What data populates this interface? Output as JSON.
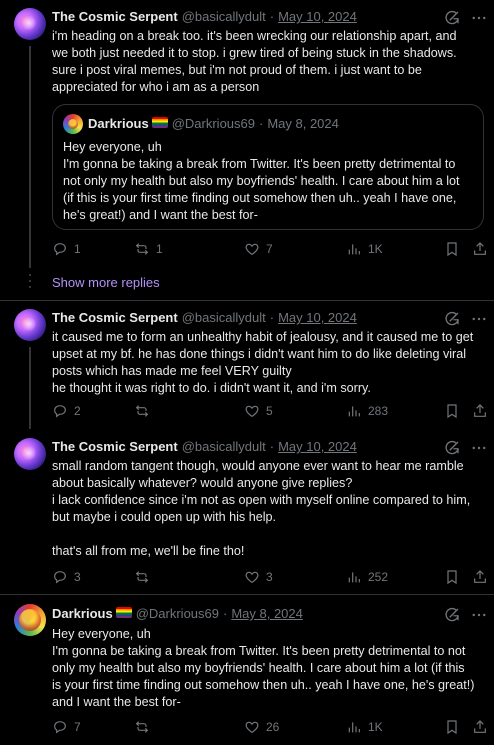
{
  "tweets": [
    {
      "name": "The Cosmic Serpent",
      "handle": "@basicallydult",
      "date": "May 10, 2024",
      "text": "i'm heading on a break too. it's been wrecking our relationship apart, and\nwe both just needed it to stop. i grew tired of being stuck in the shadows.\nsure i post viral memes, but i'm not proud of them. i just want to be\nappreciated for who i am as a person",
      "quote": {
        "name": "Darkrious",
        "handle": "@Darkrious69",
        "date": "May 8, 2024",
        "text": "Hey everyone, uh\nI'm gonna be taking a break from Twitter. It's been pretty detrimental to\nnot only my health but also my boyfriends' health. I care about him a lot\n(if this is your first time finding out somehow then uh.. yeah I have one,\nhe's great!) and I want the best for-"
      },
      "replies": "1",
      "retweets": "1",
      "likes": "7",
      "views": "1K"
    },
    {
      "name": "The Cosmic Serpent",
      "handle": "@basicallydult",
      "date": "May 10, 2024",
      "text": "it caused me to form an unhealthy habit of jealousy, and it caused me to get\nupset at my bf. he has done things i didn't want him to do like deleting viral\nposts which has made me feel VERY guilty\nhe thought it was right to do. i didn't want it, and i'm sorry.",
      "replies": "2",
      "retweets": "",
      "likes": "5",
      "views": "283"
    },
    {
      "name": "The Cosmic Serpent",
      "handle": "@basicallydult",
      "date": "May 10, 2024",
      "text": "small random tangent though, would anyone ever want to hear me ramble\nabout basically whatever? would anyone give replies?\ni lack confidence since i'm not as open with myself online compared to him,\nbut maybe i could open up with his help.\n\nthat's all from me, we'll be fine tho!",
      "replies": "3",
      "retweets": "",
      "likes": "3",
      "views": "252"
    },
    {
      "name": "Darkrious",
      "handle": "@Darkrious69",
      "date": "May 8, 2024",
      "text": "Hey everyone, uh\nI'm gonna be taking a break from Twitter. It's been pretty detrimental to not\nonly my health but also my boyfriends' health. I care about him a lot (if this\nis your first time finding out somehow then uh.. yeah I have one, he's great!)\nand I want the best for-",
      "replies": "7",
      "retweets": "",
      "likes": "26",
      "views": "1K"
    }
  ],
  "show_more_replies": "Show more replies",
  "colors": {
    "background": "#000000",
    "text": "#e7e9ea",
    "muted": "#71767b",
    "link": "#b491f7",
    "border": "#2f3336"
  },
  "icons": [
    "grok-icon",
    "more-icon",
    "reply-icon",
    "retweet-icon",
    "like-icon",
    "views-icon",
    "bookmark-icon",
    "share-icon",
    "rainbow-flag-icon"
  ]
}
